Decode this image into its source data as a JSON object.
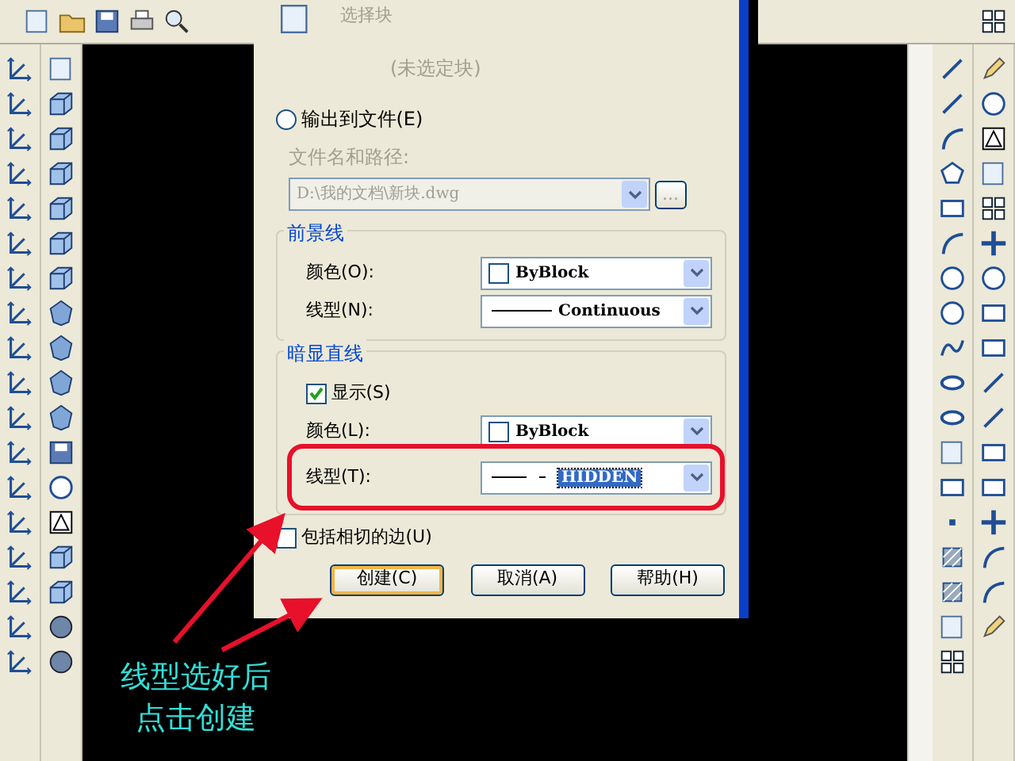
{
  "dialog": {
    "block_label": "选择块",
    "block_status": "(未选定块)",
    "output_option": {
      "label": "输出到文件(E)",
      "selected": false
    },
    "file_label": "文件名和路径:",
    "file_path": {
      "value": "D:\\我的文档\\新块.dwg",
      "disabled": true
    },
    "browse_button": "...",
    "groups": [
      {
        "title": "前景线",
        "rows": [
          {
            "kind": "color",
            "label": "颜色(O):",
            "value": "ByBlock",
            "highlighted": false,
            "circled": false
          },
          {
            "kind": "solid_linetype",
            "label": "线型(N):",
            "value": "Continuous",
            "highlighted": false,
            "circled": false
          }
        ]
      },
      {
        "title": "暗显直线",
        "rows": [
          {
            "kind": "checkbox",
            "label": "显示(S)",
            "checked": true
          },
          {
            "kind": "color",
            "label": "颜色(L):",
            "value": "ByBlock",
            "highlighted": false,
            "circled": false
          },
          {
            "kind": "dashed_linetype",
            "label": "线型(T):",
            "value": "HIDDEN",
            "highlighted": true,
            "circled": true
          }
        ]
      }
    ],
    "tangent_option": {
      "label": "包括相切的边(U)",
      "checked": false
    },
    "buttons": [
      {
        "label": "创建(C)",
        "default": true
      },
      {
        "label": "取消(A)",
        "default": false
      },
      {
        "label": "帮助(H)",
        "default": false
      }
    ]
  },
  "annotation": {
    "lines": [
      "线型选好后",
      "点击创建"
    ]
  }
}
